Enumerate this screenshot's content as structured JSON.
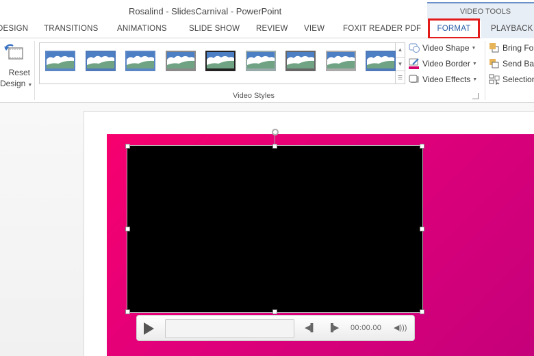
{
  "window": {
    "title": "Rosalind - SlidesCarnival - PowerPoint",
    "context_group": "VIDEO TOOLS"
  },
  "tabs": [
    {
      "label": "DESIGN"
    },
    {
      "label": "TRANSITIONS"
    },
    {
      "label": "ANIMATIONS"
    },
    {
      "label": "SLIDE SHOW"
    },
    {
      "label": "REVIEW"
    },
    {
      "label": "VIEW"
    },
    {
      "label": "FOXIT READER PDF"
    },
    {
      "label": "FORMAT",
      "selected": true,
      "highlighted": true
    },
    {
      "label": "PLAYBACK"
    }
  ],
  "ribbon": {
    "reset_design": {
      "label_line1": "Reset",
      "label_line2": "Design",
      "icon": "reset-design-icon"
    },
    "video_styles": {
      "group_label": "Video Styles",
      "thumbnail_count": 9,
      "thumbnails": [
        {
          "name": "style-1"
        },
        {
          "name": "style-2"
        },
        {
          "name": "style-3"
        },
        {
          "name": "style-4"
        },
        {
          "name": "style-5"
        },
        {
          "name": "style-6"
        },
        {
          "name": "style-7"
        },
        {
          "name": "style-8"
        },
        {
          "name": "style-9"
        }
      ],
      "commands": [
        {
          "label": "Video Shape",
          "icon": "video-shape-icon"
        },
        {
          "label": "Video Border",
          "icon": "video-border-icon"
        },
        {
          "label": "Video Effects",
          "icon": "video-effects-icon"
        }
      ]
    },
    "arrange": {
      "commands": [
        {
          "label": "Bring Fo",
          "icon": "bring-forward-icon"
        },
        {
          "label": "Send Bac",
          "icon": "send-backward-icon"
        },
        {
          "label": "Selection",
          "icon": "selection-pane-icon"
        }
      ]
    }
  },
  "player": {
    "time": "00:00.00",
    "progress": 0
  },
  "colors": {
    "slide_pink": "#f7006e",
    "highlight_red": "#e21a1a",
    "video_bg": "#000000"
  }
}
